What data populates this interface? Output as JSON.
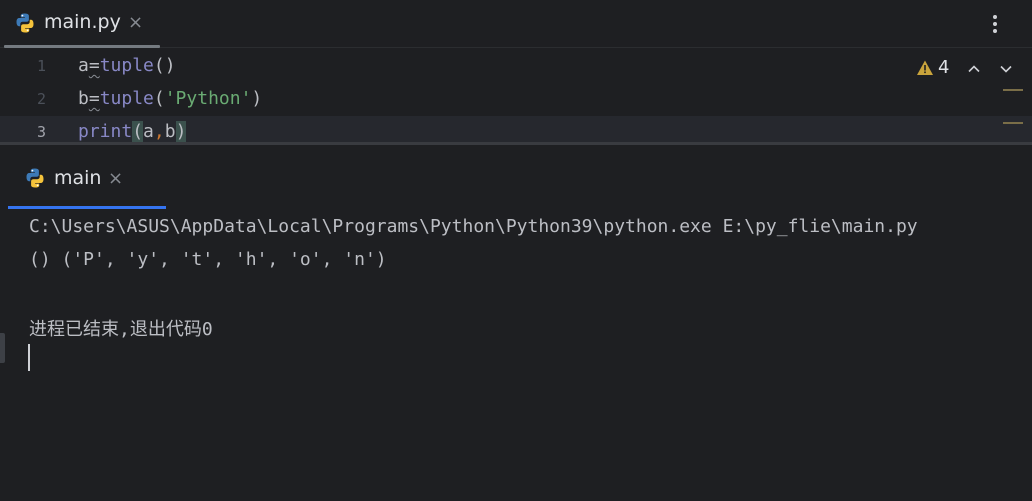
{
  "editor": {
    "tab": {
      "label": "main.py",
      "close": "×"
    },
    "lines": [
      {
        "num": "1",
        "text": "a=tuple()"
      },
      {
        "num": "2",
        "text": "b=tuple('Python')"
      },
      {
        "num": "3",
        "text": "print(a,b)"
      }
    ],
    "warnings": {
      "count": "4"
    }
  },
  "run": {
    "tab": {
      "label": "main",
      "close": "×"
    },
    "output": [
      "C:\\Users\\ASUS\\AppData\\Local\\Programs\\Python\\Python39\\python.exe E:\\py_flie\\main.py",
      "() ('P', 'y', 't', 'h', 'o', 'n')",
      "",
      "进程已结束,退出代码0"
    ]
  },
  "colors": {
    "background": "#1e1f22",
    "accent": "#3574f0",
    "string": "#6aab73",
    "builtin": "#8888c6",
    "text": "#bcbec4"
  },
  "icons": [
    "python-file-icon",
    "close-icon",
    "more-options-icon",
    "warning-icon",
    "chevron-up-icon",
    "chevron-down-icon"
  ]
}
